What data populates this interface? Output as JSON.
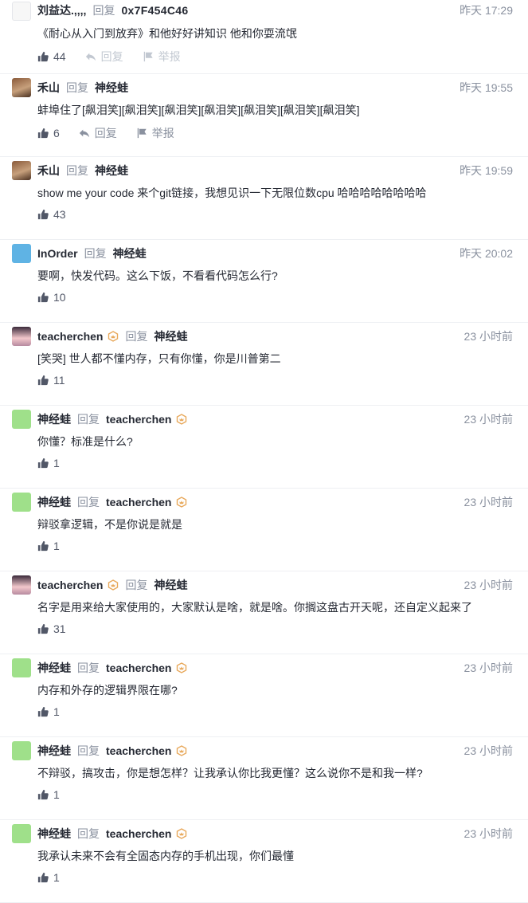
{
  "labels": {
    "reply_word": "回复",
    "reply_action": "回复",
    "report_action": "举报"
  },
  "colors": {
    "text_primary": "#252933",
    "text_secondary": "#8a919f",
    "icon_gray": "#515767",
    "divider": "#eef0f3",
    "badge_orange": "#e8a85a"
  },
  "comments": [
    {
      "author": "刘益达.,,,,",
      "reply_to": "0x7F454C46",
      "time": "昨天 17:29",
      "content": "《耐心从入门到放弃》和他好好讲知识 他和你耍流氓",
      "likes": "44",
      "avatar": "sketch-avatar",
      "show_reply_report": true,
      "reply_report_style": "faded"
    },
    {
      "author": "禾山",
      "reply_to": "神经蛙",
      "time": "昨天 19:55",
      "content": "蚌埠住了[飙泪笑][飙泪笑][飙泪笑][飙泪笑][飙泪笑][飙泪笑][飙泪笑]",
      "likes": "6",
      "avatar": "portrait-avatar",
      "show_reply_report": true,
      "reply_report_style": "active"
    },
    {
      "author": "禾山",
      "reply_to": "神经蛙",
      "time": "昨天 19:59",
      "content": "show me your code 来个git链接，我想见识一下无限位数cpu 哈哈哈哈哈哈哈哈",
      "likes": "43",
      "avatar": "portrait-avatar"
    },
    {
      "author": "InOrder",
      "reply_to": "神经蛙",
      "time": "昨天 20:02",
      "content": "要啊，快发代码。这么下饭，不看看代码怎么行?",
      "likes": "10",
      "avatar": "bird-avatar"
    },
    {
      "author": "teacherchen",
      "author_badge": true,
      "reply_to": "神经蛙",
      "time": "23 小时前",
      "content": "[笑哭] 世人都不懂内存，只有你懂，你是川普第二",
      "likes": "11",
      "avatar": "anime-avatar"
    },
    {
      "author": "神经蛙",
      "reply_to": "teacherchen",
      "target_badge": true,
      "time": "23 小时前",
      "content": "你懂？标准是什么?",
      "likes": "1",
      "avatar": "frog-avatar"
    },
    {
      "author": "神经蛙",
      "reply_to": "teacherchen",
      "target_badge": true,
      "time": "23 小时前",
      "content": "辩驳拿逻辑，不是你说是就是",
      "likes": "1",
      "avatar": "frog-avatar"
    },
    {
      "author": "teacherchen",
      "author_badge": true,
      "reply_to": "神经蛙",
      "time": "23 小时前",
      "content": "名字是用来给大家使用的，大家默认是啥，就是啥。你搁这盘古开天呢，还自定义起来了",
      "likes": "31",
      "avatar": "anime-avatar"
    },
    {
      "author": "神经蛙",
      "reply_to": "teacherchen",
      "target_badge": true,
      "time": "23 小时前",
      "content": "内存和外存的逻辑界限在哪?",
      "likes": "1",
      "avatar": "frog-avatar"
    },
    {
      "author": "神经蛙",
      "reply_to": "teacherchen",
      "target_badge": true,
      "time": "23 小时前",
      "content": "不辩驳，搞攻击，你是想怎样？让我承认你比我更懂？这么说你不是和我一样?",
      "likes": "1",
      "avatar": "frog-avatar"
    },
    {
      "author": "神经蛙",
      "reply_to": "teacherchen",
      "target_badge": true,
      "time": "23 小时前",
      "content": "我承认未来不会有全固态内存的手机出现，你们最懂",
      "likes": "1",
      "avatar": "frog-avatar"
    }
  ]
}
